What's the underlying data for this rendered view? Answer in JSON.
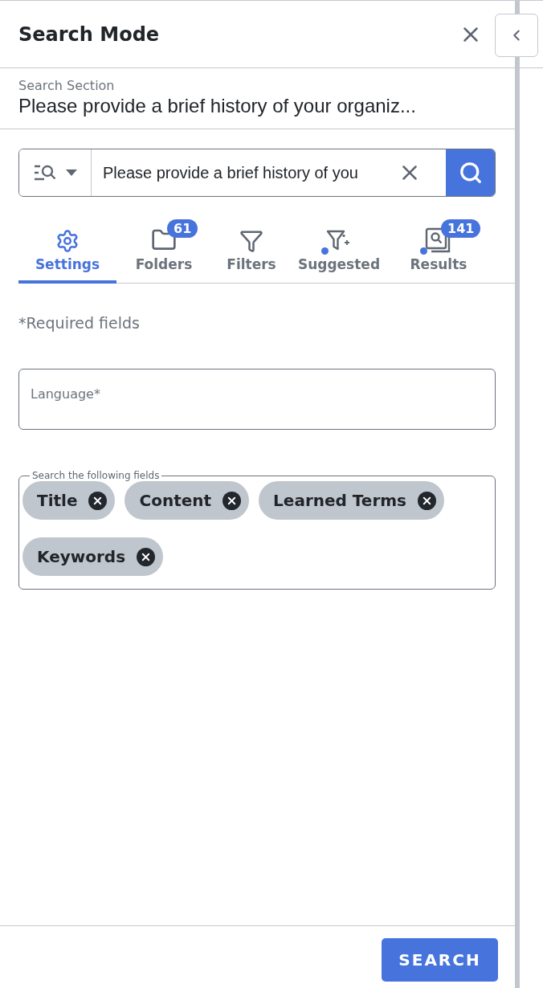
{
  "header": {
    "title": "Search Mode"
  },
  "section": {
    "label": "Search Section",
    "value": "Please provide a brief history of your organiz..."
  },
  "search": {
    "value": "Please provide a brief history of you"
  },
  "tabs": [
    {
      "kind": "settings",
      "label": "Settings",
      "selected": true,
      "dot": false
    },
    {
      "kind": "folder",
      "label": "Folders",
      "selected": false,
      "dot": false,
      "badge": "61"
    },
    {
      "kind": "filter",
      "label": "Filters",
      "selected": false,
      "dot": false
    },
    {
      "kind": "suggested",
      "label": "Suggested",
      "selected": false,
      "dot": true
    },
    {
      "kind": "results",
      "label": "Results",
      "selected": false,
      "dot": true,
      "badge": "141"
    }
  ],
  "required_note": "*Required fields",
  "language": {
    "placeholder": "Language*"
  },
  "fields": {
    "legend": "Search the following fields",
    "chips": [
      "Title",
      "Content",
      "Learned Terms",
      "Keywords"
    ]
  },
  "footer": {
    "button": "SEARCH"
  }
}
